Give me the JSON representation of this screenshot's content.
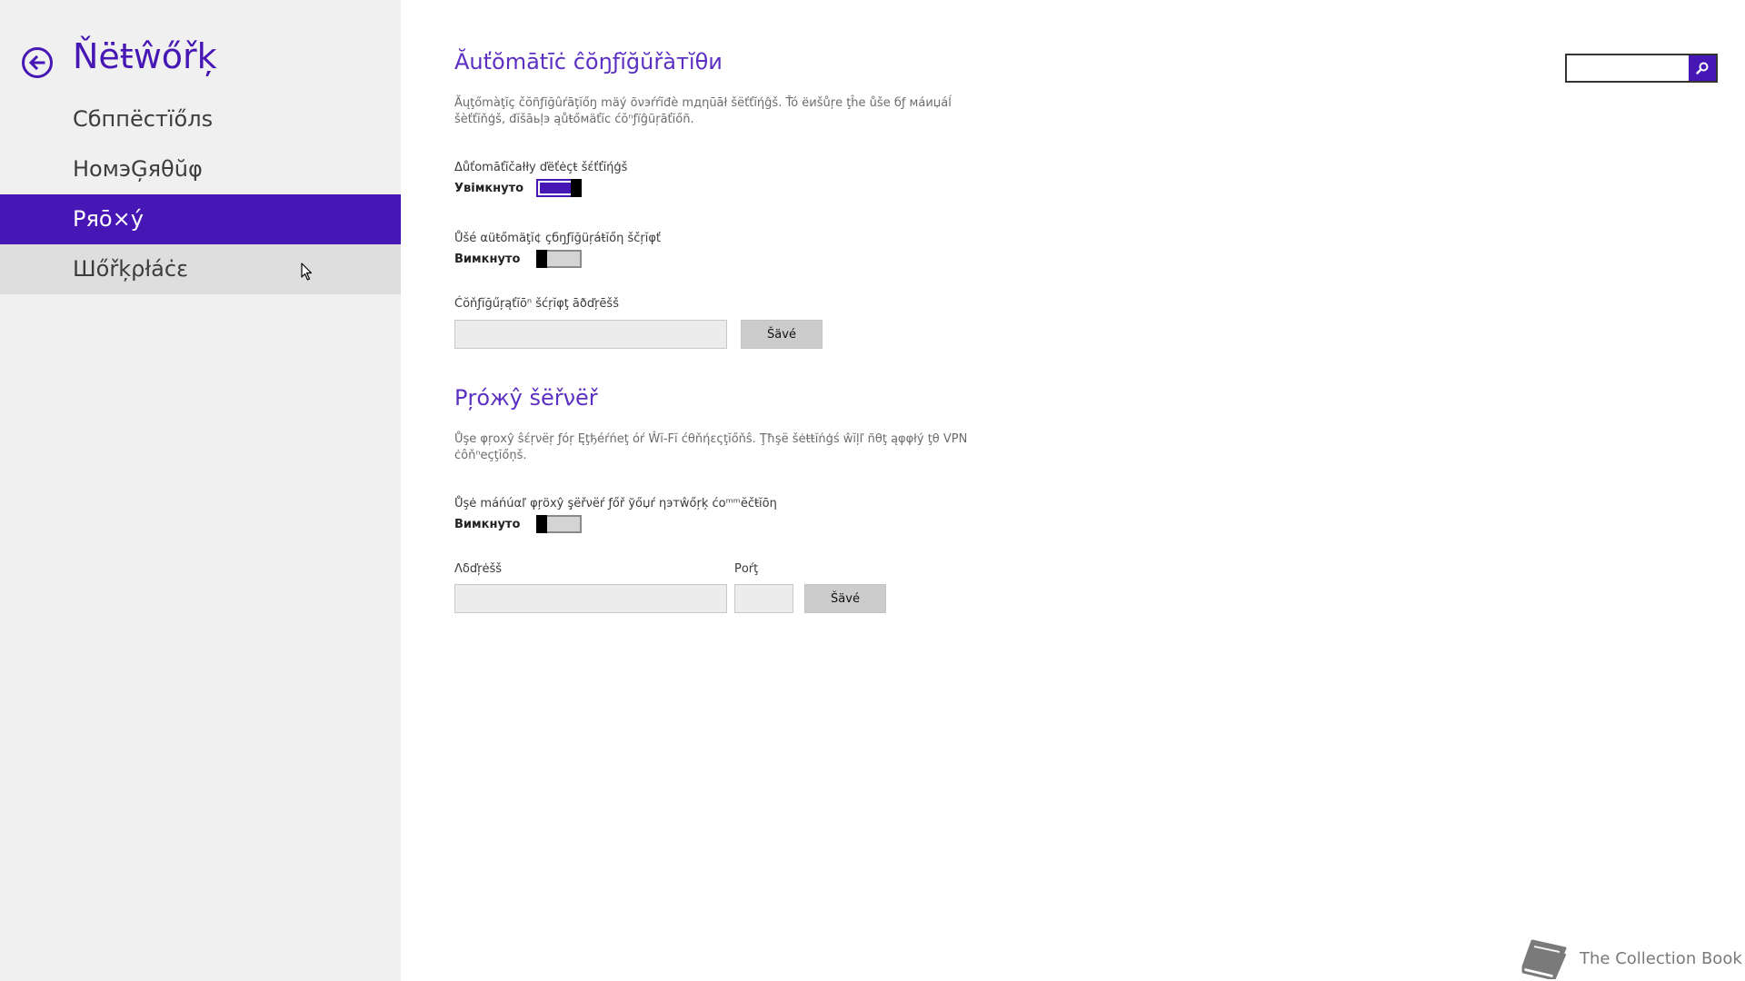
{
  "sidebar": {
    "title": "Ňëŧŵőřķ",
    "items": [
      {
        "label": "Сбппёстїőлs",
        "state": "normal"
      },
      {
        "label": "НомэĢяθŭφ",
        "state": "normal"
      },
      {
        "label": "Ряō×ý",
        "state": "selected"
      },
      {
        "label": "Шőřķρłáċε",
        "state": "hover"
      }
    ]
  },
  "search": {
    "value": "",
    "placeholder": ""
  },
  "auto_config": {
    "title": "Ăuťŏmātīċ ĉŏŋƒĭğŭřàтĭθи",
    "description": "Ăųţőmàţĭç čŏñƒĭğûŕāţĭőŋ mäý õνэŕŕĭđè mдηūāł šёťťĭήĝš. Ťó ëиšůŗе ţĥе ůšе бƒ мáиџáĺ šèťťĭňģš, đĭšāьļэ ąůŧőмäťĭс ćŏⁿƒïĝũŗāťĭőñ.",
    "detect": {
      "label": "Δůťоmāťĭčаłłу ďëťėçŧ šέťťĭήģš",
      "state_text": "Увімкнуто",
      "on": true
    },
    "script": {
      "label": "Ůšé αüŧőmäţĭ¢ çбŋƒĭğüŗáŧĭőη ščŗĭφť",
      "state_text": "Вимкнуто",
      "on": false
    },
    "address": {
      "label": "Ćŏňƒĭğűŗąťĭōⁿ šćŗĭφţ āðďŗēšš",
      "value": "",
      "save_label": "Šävé"
    }
  },
  "proxy_server": {
    "title": "Ρŗóжŷ šëřνëř",
    "description": "Ůşе φŗοхŷ ŝέŗνёŗ ƒóŗ Ęţђéŕńеţ óŕ Ŵĭ-Fĭ ćθňήεςţĭőňŝ. Ţħşё šėŧŧĭńģś ŵĭļľ ñθţ ąφφłý ţθ VPN ċôňⁿеçţĭőņš.",
    "manual": {
      "label": "Ůşė máńúαľ φŗöхŷ ş̧ёřνёŕ ƒőř ўőџŕ ηэтŵőŗķ ćοᵐᵐĕčŧĭōη",
      "state_text": "Вимкнуто",
      "on": false
    },
    "address_label": "Λδďŗėšš",
    "address_value": "",
    "port_label": "Ροŕţ",
    "port_value": "",
    "save_label": "Šävé"
  },
  "watermark": {
    "text": "The Collection Book"
  },
  "colors": {
    "accent": "#4617b4",
    "sidebar_bg": "#f0f0f0",
    "hover_bg": "#dedede"
  }
}
